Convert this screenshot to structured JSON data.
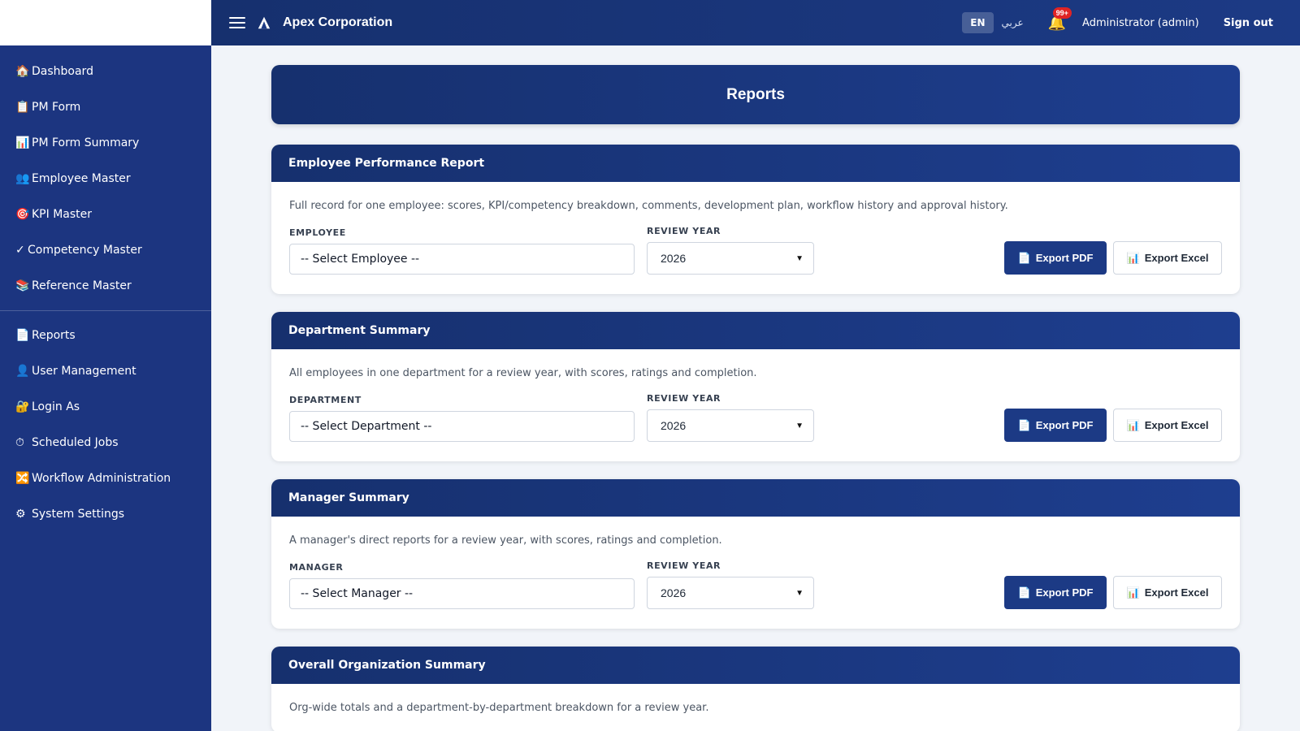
{
  "app": {
    "name": "Apex Corporation"
  },
  "sidebar": {
    "items": [
      {
        "icon": "🏠",
        "label": "Dashboard"
      },
      {
        "icon": "📋",
        "label": "PM Form"
      },
      {
        "icon": "📊",
        "label": "PM Form Summary"
      },
      {
        "icon": "👥",
        "label": "Employee Master"
      },
      {
        "icon": "🎯",
        "label": "KPI Master"
      },
      {
        "icon": "✓",
        "label": "Competency Master"
      },
      {
        "icon": "📚",
        "label": "Reference Master"
      }
    ],
    "items2": [
      {
        "icon": "📄",
        "label": "Reports"
      },
      {
        "icon": "👤",
        "label": "User Management"
      },
      {
        "icon": "🔐",
        "label": "Login As"
      },
      {
        "icon": "⏱",
        "label": "Scheduled Jobs"
      },
      {
        "icon": "🔀",
        "label": "Workflow Administration"
      },
      {
        "icon": "⚙",
        "label": "System Settings"
      }
    ]
  },
  "topbar": {
    "lang_en": "EN",
    "lang_ar": "عربي",
    "notifications_badge": "99+",
    "user": "Administrator (admin)",
    "signout": "Sign out"
  },
  "page": {
    "title": "Reports"
  },
  "buttons": {
    "pdf": "Export PDF",
    "excel": "Export Excel",
    "pdf_icon": "📄",
    "excel_icon": "📊"
  },
  "reports": [
    {
      "title": "Employee Performance Report",
      "description": "Full record for one employee: scores, KPI/competency breakdown, comments, development plan, workflow history and approval history.",
      "field_label": "EMPLOYEE",
      "field_value": "-- Select Employee --",
      "year_label": "REVIEW YEAR",
      "year_value": "2026"
    },
    {
      "title": "Department Summary",
      "description": "All employees in one department for a review year, with scores, ratings and completion.",
      "field_label": "DEPARTMENT",
      "field_value": "-- Select Department --",
      "year_label": "REVIEW YEAR",
      "year_value": "2026"
    },
    {
      "title": "Manager Summary",
      "description": "A manager's direct reports for a review year, with scores, ratings and completion.",
      "field_label": "MANAGER",
      "field_value": "-- Select Manager --",
      "year_label": "REVIEW YEAR",
      "year_value": "2026"
    },
    {
      "title": "Overall Organization Summary",
      "description": "Org-wide totals and a department-by-department breakdown for a review year."
    }
  ]
}
